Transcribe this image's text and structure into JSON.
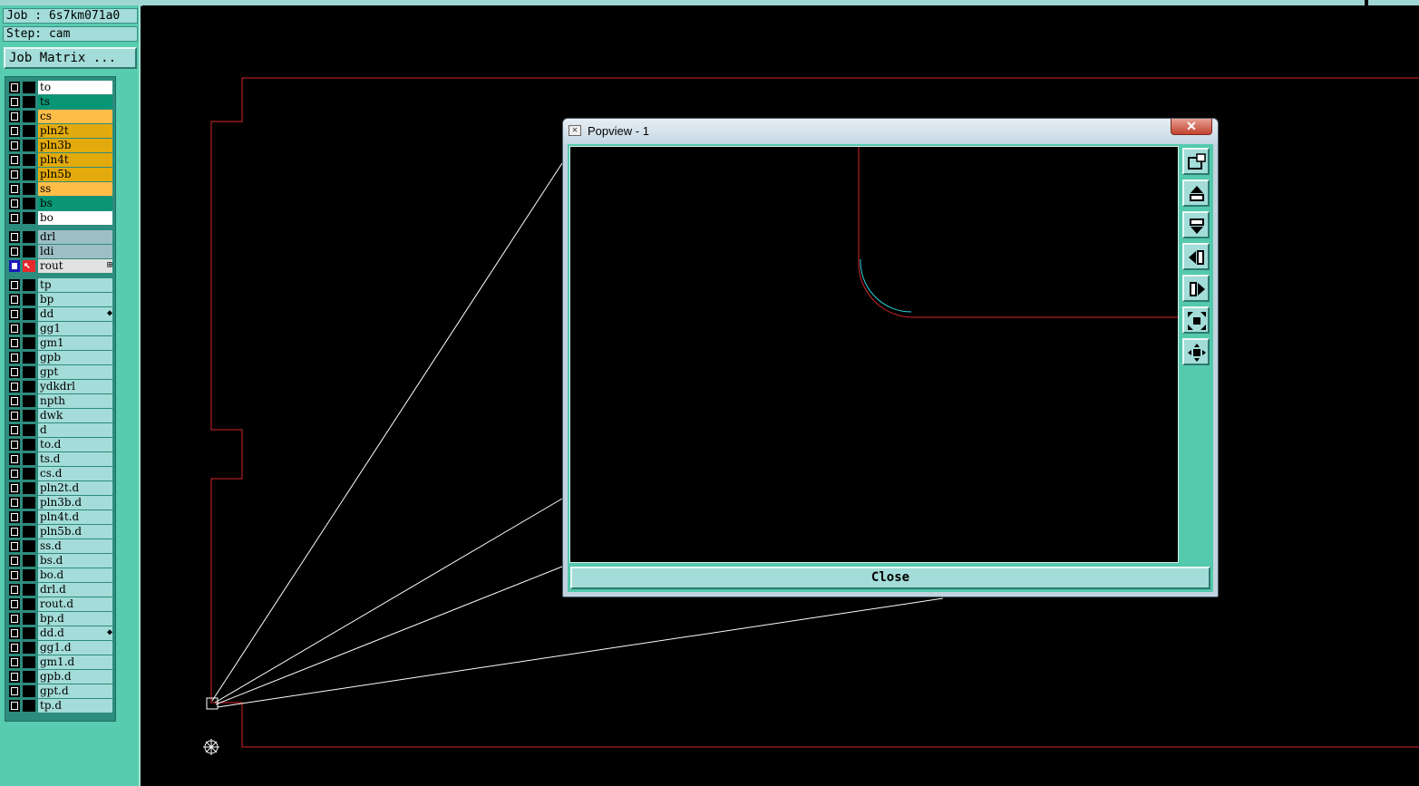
{
  "header": {
    "job": "Job : 6s7km071a0",
    "step": "Step: cam",
    "job_matrix_label": "Job Matrix ..."
  },
  "layers": [
    {
      "name": "to",
      "color": "#ffffff",
      "group": "board"
    },
    {
      "name": "ts",
      "color": "#0a9675",
      "group": "board"
    },
    {
      "name": "cs",
      "color": "#fdbd47",
      "group": "board"
    },
    {
      "name": "pln2t",
      "color": "#e2aa0d",
      "group": "board"
    },
    {
      "name": "pln3b",
      "color": "#e2aa0d",
      "group": "board"
    },
    {
      "name": "pln4t",
      "color": "#e2aa0d",
      "group": "board"
    },
    {
      "name": "pln5b",
      "color": "#e2aa0d",
      "group": "board"
    },
    {
      "name": "ss",
      "color": "#fdbd47",
      "group": "board"
    },
    {
      "name": "bs",
      "color": "#0a9675",
      "group": "board"
    },
    {
      "name": "bo",
      "color": "#ffffff",
      "group": "board"
    },
    {
      "name": "drl",
      "color": "#9dbec5",
      "group": "drill"
    },
    {
      "name": "ldi",
      "color": "#9dbec5",
      "group": "drill"
    },
    {
      "name": "rout",
      "color": "#e1e1e1",
      "group": "drill",
      "active": true,
      "mark": "⊞"
    },
    {
      "name": "tp",
      "color": "#a3dcd8",
      "group": "misc"
    },
    {
      "name": "bp",
      "color": "#a3dcd8",
      "group": "misc"
    },
    {
      "name": "dd",
      "color": "#a3dcd8",
      "group": "misc",
      "mark": "◆"
    },
    {
      "name": "gg1",
      "color": "#a3dcd8",
      "group": "misc"
    },
    {
      "name": "gm1",
      "color": "#a3dcd8",
      "group": "misc"
    },
    {
      "name": "gpb",
      "color": "#a3dcd8",
      "group": "misc"
    },
    {
      "name": "gpt",
      "color": "#a3dcd8",
      "group": "misc"
    },
    {
      "name": "ydkdrl",
      "color": "#a3dcd8",
      "group": "misc"
    },
    {
      "name": "npth",
      "color": "#a3dcd8",
      "group": "misc"
    },
    {
      "name": "dwk",
      "color": "#a3dcd8",
      "group": "misc"
    },
    {
      "name": "d",
      "color": "#a3dcd8",
      "group": "misc"
    },
    {
      "name": "to.d",
      "color": "#a3dcd8",
      "group": "misc"
    },
    {
      "name": "ts.d",
      "color": "#a3dcd8",
      "group": "misc"
    },
    {
      "name": "cs.d",
      "color": "#a3dcd8",
      "group": "misc"
    },
    {
      "name": "pln2t.d",
      "color": "#a3dcd8",
      "group": "misc"
    },
    {
      "name": "pln3b.d",
      "color": "#a3dcd8",
      "group": "misc"
    },
    {
      "name": "pln4t.d",
      "color": "#a3dcd8",
      "group": "misc"
    },
    {
      "name": "pln5b.d",
      "color": "#a3dcd8",
      "group": "misc"
    },
    {
      "name": "ss.d",
      "color": "#a3dcd8",
      "group": "misc"
    },
    {
      "name": "bs.d",
      "color": "#a3dcd8",
      "group": "misc"
    },
    {
      "name": "bo.d",
      "color": "#a3dcd8",
      "group": "misc"
    },
    {
      "name": "drl.d",
      "color": "#a3dcd8",
      "group": "misc"
    },
    {
      "name": "rout.d",
      "color": "#a3dcd8",
      "group": "misc"
    },
    {
      "name": "bp.d",
      "color": "#a3dcd8",
      "group": "misc"
    },
    {
      "name": "dd.d",
      "color": "#a3dcd8",
      "group": "misc",
      "mark": "◆"
    },
    {
      "name": "gg1.d",
      "color": "#a3dcd8",
      "group": "misc"
    },
    {
      "name": "gm1.d",
      "color": "#a3dcd8",
      "group": "misc"
    },
    {
      "name": "gpb.d",
      "color": "#a3dcd8",
      "group": "misc"
    },
    {
      "name": "gpt.d",
      "color": "#a3dcd8",
      "group": "misc"
    },
    {
      "name": "tp.d",
      "color": "#a3dcd8",
      "group": "misc"
    }
  ],
  "popview": {
    "title": "Popview - 1",
    "close_x": "✕",
    "close_label": "Close",
    "tools": [
      {
        "name": "zoom-window-icon"
      },
      {
        "name": "pan-up-icon"
      },
      {
        "name": "pan-down-icon"
      },
      {
        "name": "pan-left-icon"
      },
      {
        "name": "pan-right-icon"
      },
      {
        "name": "zoom-in-icon"
      },
      {
        "name": "zoom-out-icon"
      }
    ]
  },
  "colors": {
    "panel": "#58ccb0",
    "outline": "#d6252b",
    "zoom_lines": "#ffffff",
    "highlight": "#2fd6e0"
  }
}
